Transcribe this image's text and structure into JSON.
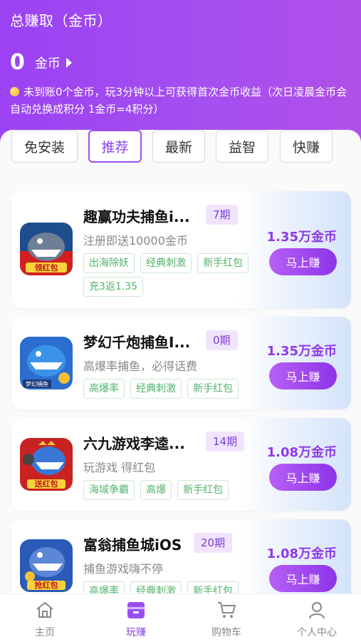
{
  "header": {
    "title": "总赚取（金币）",
    "balance": "0",
    "balance_unit": "金币",
    "notice": "未到账0个金币，玩3分钟以上可获得首次金币收益（次日凌晨金币会自动兑换成积分 1金币=4积分）"
  },
  "tabs": [
    {
      "label": "免安装",
      "active": false
    },
    {
      "label": "推荐",
      "active": true
    },
    {
      "label": "最新",
      "active": false
    },
    {
      "label": "益智",
      "active": false
    },
    {
      "label": "快赚",
      "active": false
    }
  ],
  "games": [
    {
      "name": "趣赢功夫捕鱼i...",
      "period": "7期",
      "desc": "注册即送10000金币",
      "tags": [
        "出海除妖",
        "经典刺激",
        "新手红包",
        "充3返1.35"
      ],
      "amount": "1.35万金币",
      "button": "马上赚",
      "icon_label": "领红包"
    },
    {
      "name": "梦幻千炮捕鱼I...",
      "period": "0期",
      "desc": "高爆率捕鱼，必得话费",
      "tags": [
        "高爆率",
        "经典刺激",
        "新手红包"
      ],
      "amount": "1.35万金币",
      "button": "马上赚",
      "icon_label": "梦幻捕鱼"
    },
    {
      "name": "六九游戏李逵...",
      "period": "14期",
      "desc": "玩游戏 得红包",
      "tags": [
        "海域争霸",
        "高爆",
        "新手红包"
      ],
      "amount": "1.08万金币",
      "button": "马上赚",
      "icon_label": "送红包"
    },
    {
      "name": "富翁捕鱼城iOS",
      "period": "20期",
      "desc": "捕鱼游戏嗨不停",
      "tags": [
        "高爆率",
        "经典刺激",
        "新手红包"
      ],
      "amount": "1.08万金币",
      "button": "马上赚",
      "icon_label": "抢红包"
    }
  ],
  "nav": [
    {
      "label": "主页",
      "icon": "home-icon",
      "active": false
    },
    {
      "label": "玩赚",
      "icon": "play-earn-icon",
      "active": true
    },
    {
      "label": "购物车",
      "icon": "cart-icon",
      "active": false
    },
    {
      "label": "个人中心",
      "icon": "profile-icon",
      "active": false
    }
  ],
  "colors": {
    "accent": "#8e3ff0",
    "tag_green": "#52b36a",
    "period_bg": "#f0e4fd"
  }
}
